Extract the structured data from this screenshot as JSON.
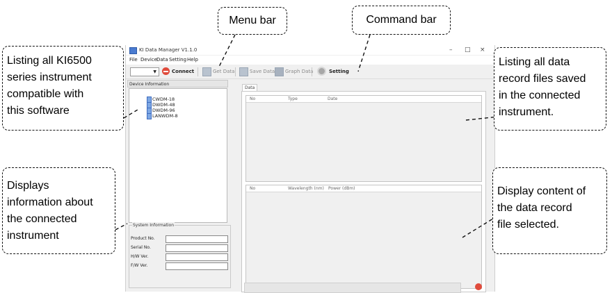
{
  "window": {
    "title": "KI Data Manager V1.1.0",
    "controls": [
      "–",
      "□",
      "×"
    ]
  },
  "menu": [
    "File",
    "Device",
    "Data",
    "Setting",
    "Help"
  ],
  "toolbar": {
    "connect": "Connect",
    "get_data": "Get Data",
    "save_data": "Save Data",
    "graph_data": "Graph Data",
    "setting": "Setting"
  },
  "device_panel": {
    "header": "Device Information",
    "devices": [
      "CWDM-18",
      "DWDM-48",
      "DWDM-96",
      "LANWDM-8"
    ]
  },
  "system_info": {
    "legend": "System Information",
    "fields": [
      "Product No.",
      "Serial No.",
      "H/W Ver.",
      "F/W Ver."
    ]
  },
  "data_panel": {
    "tab": "Data",
    "files_columns": [
      "No",
      "Type",
      "Date"
    ],
    "content_columns": [
      "No",
      "Wavelength (nm)",
      "Power (dBm)"
    ]
  },
  "callouts": {
    "menu_bar": "Menu bar",
    "command_bar": "Command bar",
    "instruments": [
      "Listing all KI6500",
      "series instrument",
      "compatible with",
      "this software"
    ],
    "record_files": [
      "Listing all data",
      "record files saved",
      "in the connected",
      "instrument."
    ],
    "info": [
      "Displays",
      "information about",
      "the connected",
      "instrument"
    ],
    "content": [
      "Display content of",
      "the data record",
      "file selected."
    ]
  }
}
